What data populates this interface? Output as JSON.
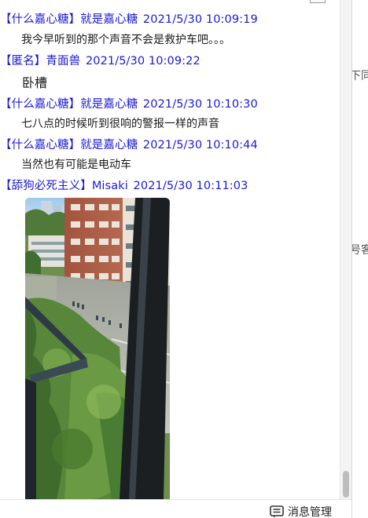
{
  "messages": [
    {
      "group": "【什么嘉心糖】",
      "name": "就是嘉心糖",
      "time": "2021/5/30 10:09:19",
      "text": "我今早听到的那个声音不会是救护车吧。。。"
    },
    {
      "group": "【匿名】",
      "name": "青面兽",
      "time": "2021/5/30 10:09:22",
      "text": "卧槽"
    },
    {
      "group": "【什么嘉心糖】",
      "name": "就是嘉心糖",
      "time": "2021/5/30 10:10:30",
      "text": "七八点的时候听到很响的警报一样的声音"
    },
    {
      "group": "【什么嘉心糖】",
      "name": "就是嘉心糖",
      "time": "2021/5/30 10:10:44",
      "text": "当然也有可能是电动车"
    },
    {
      "group": "【舔狗必死主义】",
      "name": "Misaki",
      "time": "2021/5/30 10:11:03",
      "text": ""
    }
  ],
  "side_fragments": [
    "下同",
    "号客"
  ],
  "footer": {
    "manage_label": "消息管理",
    "manage_icon": "message-manage-icon"
  },
  "colors": {
    "sender": "#1a1ad6",
    "body": "#1a1a1a"
  }
}
